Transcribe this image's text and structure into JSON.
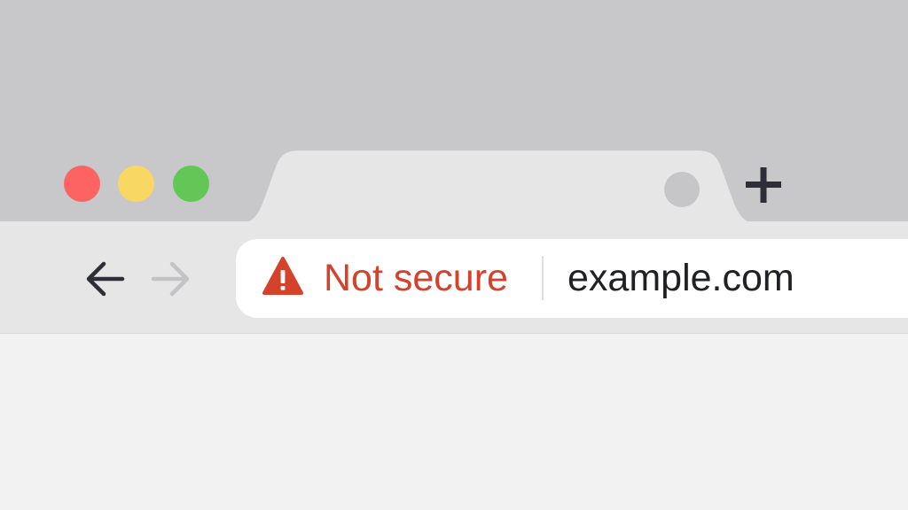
{
  "window": {
    "controls": [
      {
        "name": "close",
        "color": "#fe6363"
      },
      {
        "name": "minimize",
        "color": "#f8d763"
      },
      {
        "name": "maximize",
        "color": "#64c657"
      }
    ]
  },
  "tab": {
    "close_icon": "circle-close-icon",
    "new_tab_icon": "plus-icon"
  },
  "toolbar": {
    "back_icon": "arrow-left-icon",
    "forward_icon": "arrow-right-icon",
    "forward_enabled": false
  },
  "address_bar": {
    "security_icon": "warning-triangle-icon",
    "security_label": "Not secure",
    "security_color": "#d4422c",
    "url": "example.com"
  }
}
